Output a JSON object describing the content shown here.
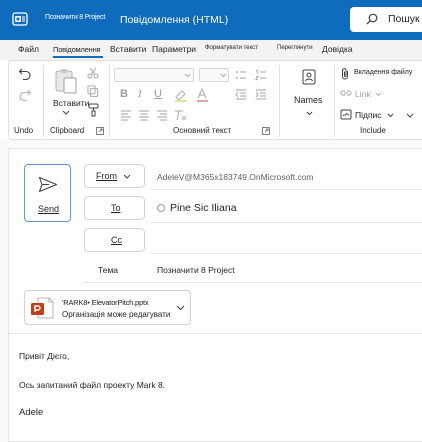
{
  "titlebar": {
    "subject_short": "Позначити 8 Project",
    "window_title": "Повідомлення (HTML)",
    "search_label": "Пошук"
  },
  "tabs": [
    {
      "label": "Файл"
    },
    {
      "label": "Повідомлення",
      "active": true
    },
    {
      "label": "Вставити"
    },
    {
      "label": "Параметри"
    },
    {
      "label": "Форматувати текст"
    },
    {
      "label": "Переглянути"
    },
    {
      "label": "Довідка"
    }
  ],
  "ribbon": {
    "undo_group": "Undo",
    "paste_label": "Вставити",
    "clipboard_group": "Clipboard",
    "basic_text_group": "Основний текст",
    "bold": "B",
    "italic": "I",
    "underline": "U",
    "names_label": "Names",
    "attach_file": "Вкладення файлу",
    "link": "Link",
    "signature": "Підпис",
    "include_group": "Include"
  },
  "compose": {
    "send_label": "Send",
    "from_label": "From",
    "from_address": "AdeleV@M365x183749.OnMicrosoft.com",
    "to_label": "To",
    "to_recipient": "Pine Sic Iliana",
    "cc_label": "Cc",
    "subject_label": "Тема",
    "subject_value": "Позначити 8 Project"
  },
  "attachment": {
    "filename": "'RARK8• ElevatorPitch.pptx",
    "permission": "Організація може редагувати"
  },
  "body": {
    "greeting": "Привіт Дієго,",
    "message": "Ось запитаний файл проекту Mark 8.",
    "signature": "Adele"
  },
  "colors": {
    "accent": "#0f6cbd",
    "powerpoint": "#c43e1c"
  }
}
